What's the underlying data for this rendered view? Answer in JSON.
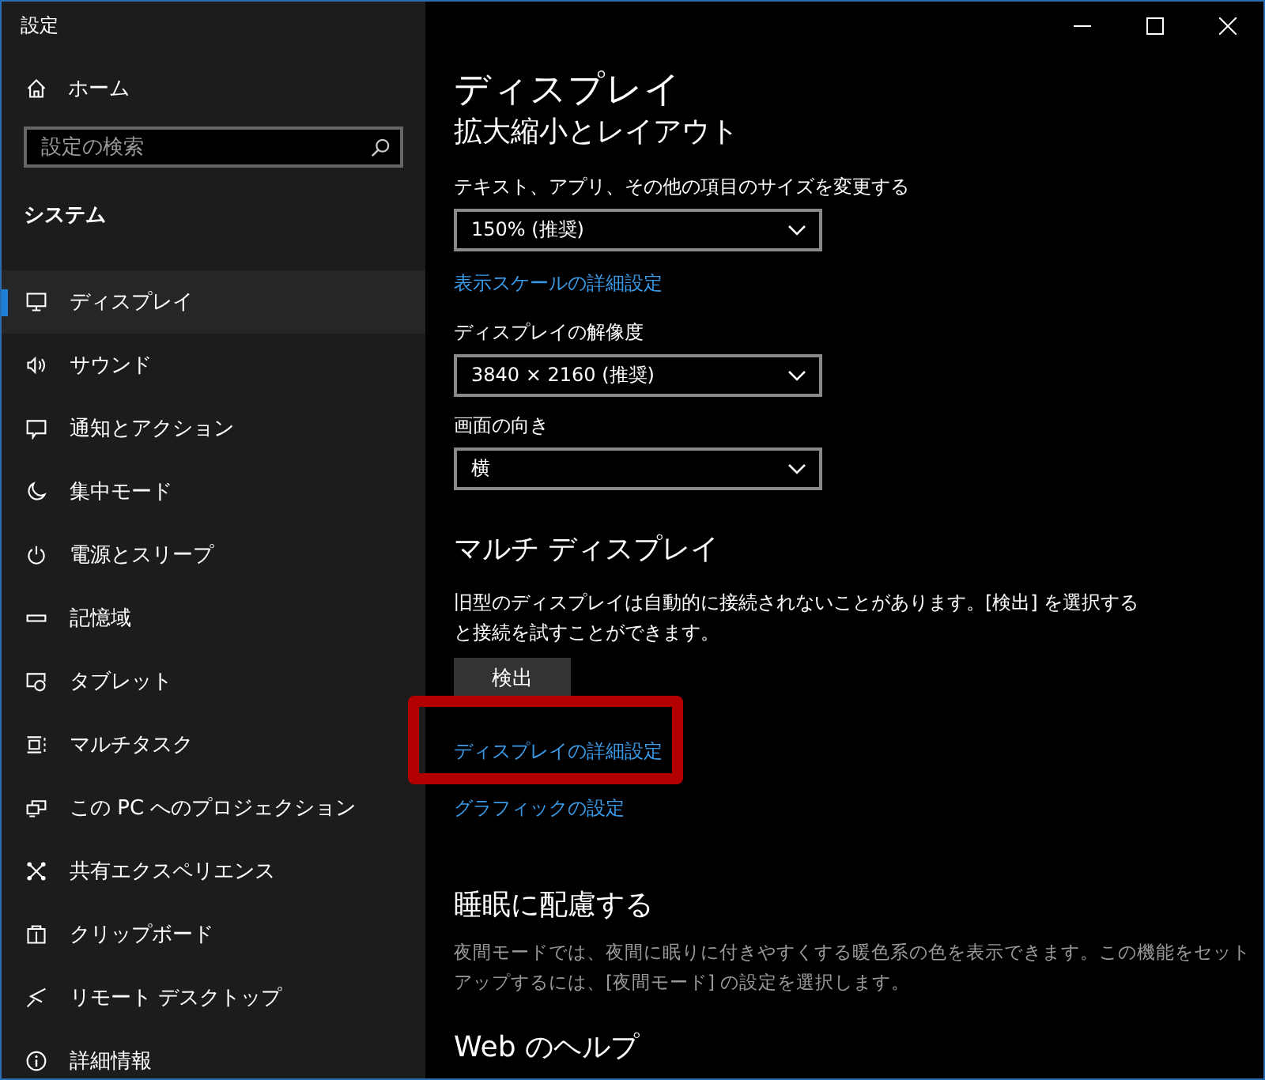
{
  "window": {
    "title": "設定"
  },
  "sidebar": {
    "home": "ホーム",
    "search": {
      "placeholder": "設定の検索"
    },
    "section": "システム",
    "items": [
      {
        "label": "ディスプレイ",
        "selected": true
      },
      {
        "label": "サウンド",
        "selected": false
      },
      {
        "label": "通知とアクション",
        "selected": false
      },
      {
        "label": "集中モード",
        "selected": false
      },
      {
        "label": "電源とスリープ",
        "selected": false
      },
      {
        "label": "記憶域",
        "selected": false
      },
      {
        "label": "タブレット",
        "selected": false
      },
      {
        "label": "マルチタスク",
        "selected": false
      },
      {
        "label": "この PC へのプロジェクション",
        "selected": false
      },
      {
        "label": "共有エクスペリエンス",
        "selected": false
      },
      {
        "label": "クリップボード",
        "selected": false
      },
      {
        "label": "リモート デスクトップ",
        "selected": false
      },
      {
        "label": "詳細情報",
        "selected": false
      }
    ]
  },
  "page": {
    "title": "ディスプレイ",
    "scale_section": {
      "heading": "拡大縮小とレイアウト",
      "size_label": "テキスト、アプリ、その他の項目のサイズを変更する",
      "size_value": "150% (推奨)",
      "scale_link": "表示スケールの詳細設定",
      "resolution_label": "ディスプレイの解像度",
      "resolution_value": "3840 × 2160 (推奨)",
      "orientation_label": "画面の向き",
      "orientation_value": "横"
    },
    "multi_section": {
      "heading": "マルチ ディスプレイ",
      "text": "旧型のディスプレイは自動的に接続されないことがあります。[検出] を選択すると接続を試すことができます。",
      "detect_button": "検出",
      "links": [
        {
          "label": "ディスプレイの詳細設定",
          "highlighted": true
        },
        {
          "label": "グラフィックの設定",
          "highlighted": false
        }
      ]
    },
    "sleep_section": {
      "heading": "睡眠に配慮する",
      "text": "夜間モードでは、夜間に眠りに付きやすくする暖色系の色を表示できます。この機能をセットアップするには、[夜間モード] の設定を選択します。"
    },
    "help_heading": "Web のヘルプ"
  }
}
